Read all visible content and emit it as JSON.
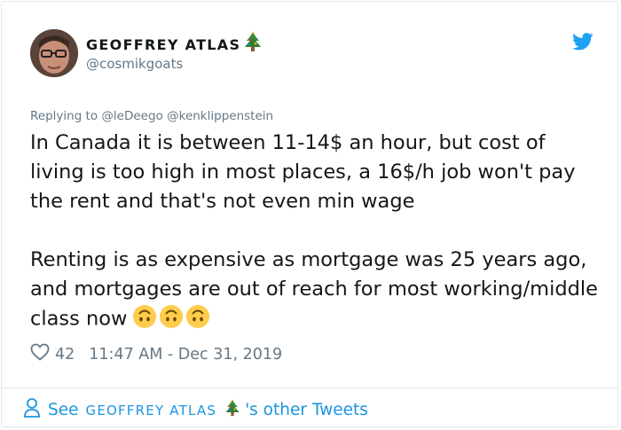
{
  "author": {
    "display_name": "GEOFFREY ATLAS",
    "handle": "@cosmikgoats",
    "name_emoji": "christmas-tree-icon"
  },
  "reply": {
    "prefix": "Replying to",
    "mentions": [
      "@leDeego",
      "@kenklippenstein"
    ]
  },
  "tweet": {
    "paragraph_1": "In Canada it is between 11-14$ an hour, but cost of living is too high in most places, a 16$/h job won't pay the rent and that's not even min wage",
    "paragraph_2": "Renting is as expensive as mortgage was 25 years ago, and mortgages are out of reach for most working/middle class now",
    "trailing_emojis": [
      "upside-down-face-icon",
      "upside-down-face-icon",
      "upside-down-face-icon"
    ]
  },
  "meta": {
    "likes": "42",
    "timestamp": "11:47 AM - Dec 31, 2019"
  },
  "footer": {
    "see": "See",
    "name": "GEOFFREY ATLAS",
    "suffix": "'s other Tweets"
  },
  "colors": {
    "text": "#14171a",
    "muted": "#657786",
    "link": "#1b95e0",
    "twitter_blue": "#1da1f2",
    "border": "#e1e8ed"
  }
}
